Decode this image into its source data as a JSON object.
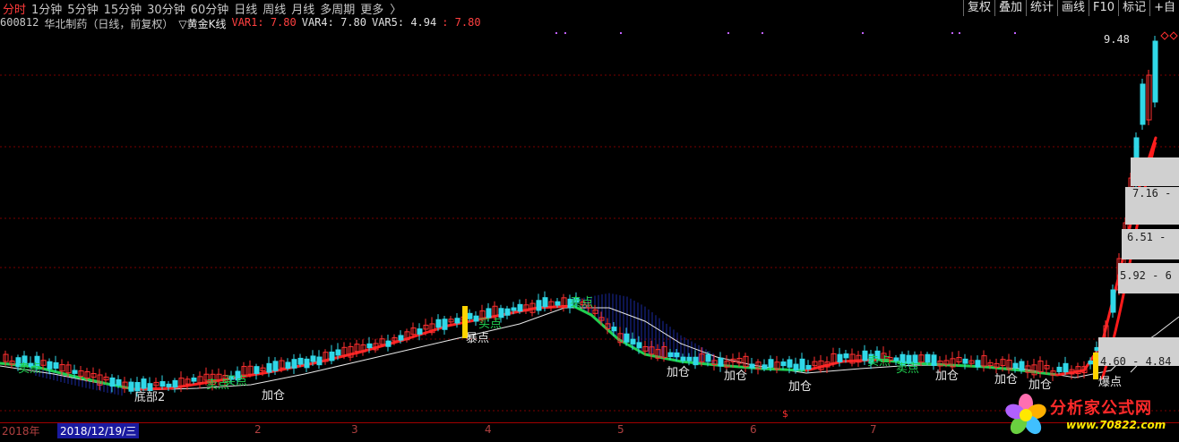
{
  "toolbar": {
    "periods": [
      "分时",
      "1分钟",
      "5分钟",
      "15分钟",
      "30分钟",
      "60分钟",
      "日线",
      "周线",
      "月线",
      "多周期",
      "更多"
    ],
    "more_arrow": "〉",
    "buttons": [
      "复权",
      "叠加",
      "统计",
      "画线",
      "F10",
      "标记",
      "+自"
    ]
  },
  "info": {
    "code": "600812",
    "name": "华北制药（日线，前复权）",
    "indicator": "▽黄金K线",
    "var1": "VAR1: 7.80",
    "var4": "VAR4: 7.80",
    "var5": "VAR5: 4.94",
    "var6": ": 7.80"
  },
  "chart_data": {
    "type": "candlestick",
    "price_labels": [
      "9.48",
      "7.16 -",
      "6.51 -",
      "5.92 - 6",
      "4.60 - 4.84"
    ],
    "signals": [
      "卖点",
      "底部2",
      "买点",
      "加仓",
      "卖点",
      "买点",
      "暴点",
      "卖点",
      "卖点",
      "加仓",
      "加仓",
      "加仓",
      "卖点",
      "加仓",
      "加仓",
      "加仓",
      "爆点"
    ],
    "axis": {
      "year": "2018年",
      "cursor_date": "2018/12/19/三",
      "months": [
        "2",
        "3",
        "4",
        "5",
        "6",
        "7"
      ]
    }
  },
  "watermark": {
    "text": "分析家公式网",
    "url": "www.70822.com"
  },
  "colors": {
    "up": "#ff3030",
    "down": "#30d8e8",
    "ma_up": "#ff2020",
    "ma_down": "#20d050",
    "fill": "#1a2aa0",
    "grid": "#7a0000"
  }
}
